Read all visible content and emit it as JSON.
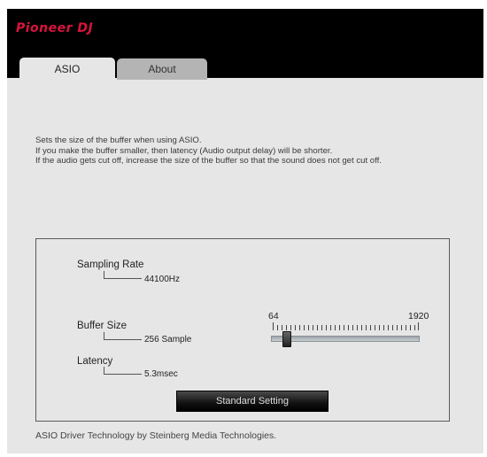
{
  "brand": {
    "logo_text": "Pioneer DJ",
    "accent_color": "#d8143c"
  },
  "tabs": [
    {
      "label": "ASIO",
      "active": true
    },
    {
      "label": "About",
      "active": false
    }
  ],
  "description": [
    "Sets the size of the buffer when using ASIO.",
    "If you make the buffer smaller, then latency (Audio output delay) will be shorter.",
    "If the audio gets cut off, increase the size of the buffer so that the sound does not get cut off."
  ],
  "settings": {
    "sampling_rate": {
      "label": "Sampling Rate",
      "value": "44100Hz"
    },
    "buffer_size": {
      "label": "Buffer Size",
      "value": "256 Sample"
    },
    "latency": {
      "label": "Latency",
      "value": "5.3msec"
    }
  },
  "slider": {
    "min_label": "64",
    "max_label": "1920",
    "value": 256,
    "min": 64,
    "max": 1920
  },
  "standard_button": {
    "label": "Standard Setting"
  },
  "footer": {
    "text": "ASIO Driver Technology by Steinberg Media Technologies."
  }
}
